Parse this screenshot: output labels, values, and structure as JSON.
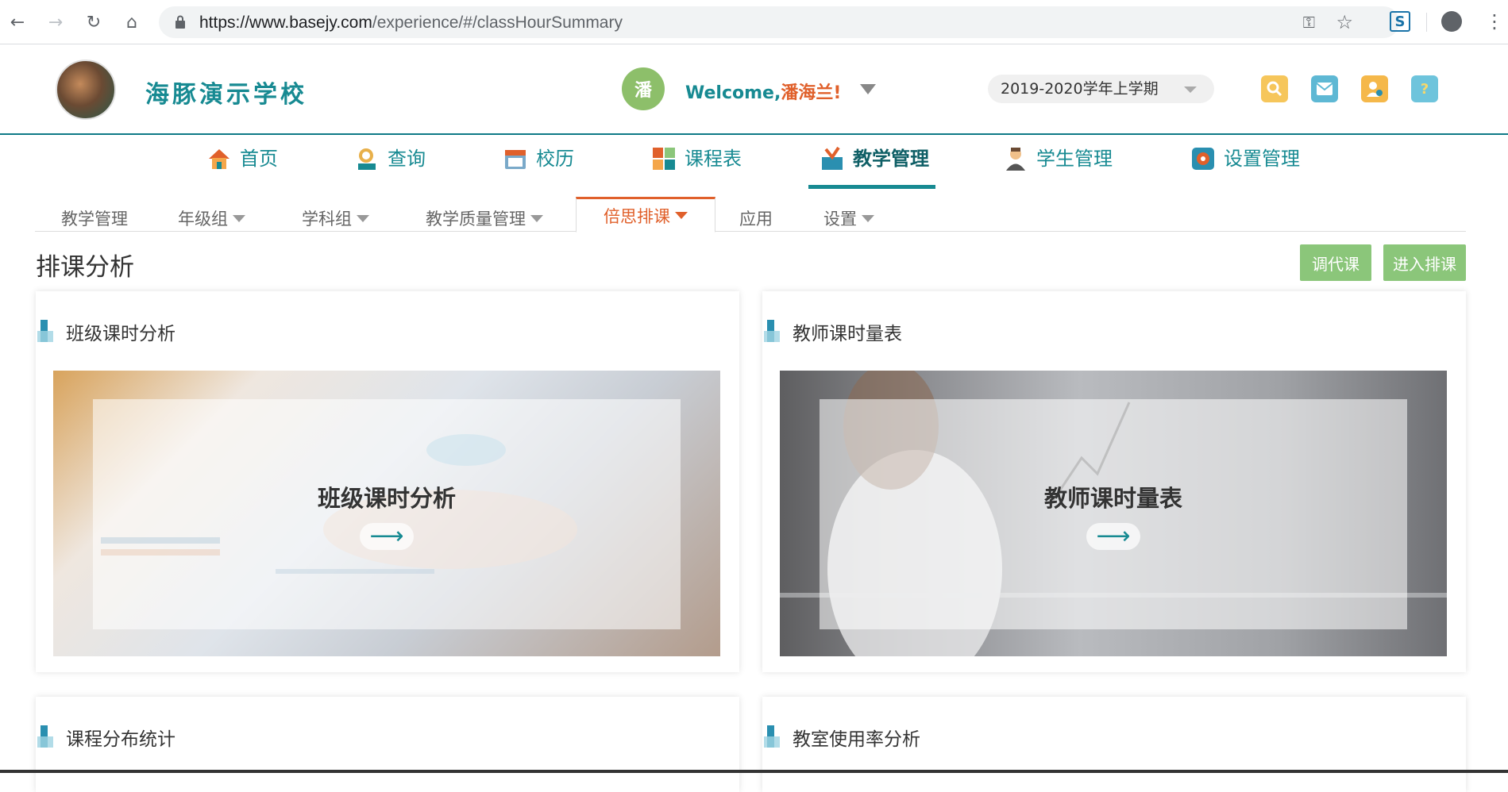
{
  "browser": {
    "url_host": "https://www.basejy.com",
    "url_path": "/experience/#/classHourSummary"
  },
  "header": {
    "school_name": "海豚演示学校",
    "avatar_char": "潘",
    "welcome_prefix": "Welcome,",
    "user_name": "潘海兰!",
    "term": "2019-2020学年上学期",
    "help_char": "?"
  },
  "main_nav": {
    "items": [
      {
        "label": "首页"
      },
      {
        "label": "查询"
      },
      {
        "label": "校历"
      },
      {
        "label": "课程表"
      },
      {
        "label": "教学管理"
      },
      {
        "label": "学生管理"
      },
      {
        "label": "设置管理"
      }
    ],
    "active": "教学管理"
  },
  "sub_nav": {
    "items": [
      {
        "label": "教学管理"
      },
      {
        "label": "年级组"
      },
      {
        "label": "学科组"
      },
      {
        "label": "教学质量管理"
      },
      {
        "label": "倍思排课"
      },
      {
        "label": "应用"
      },
      {
        "label": "设置"
      }
    ],
    "active": "倍思排课"
  },
  "page": {
    "title": "排课分析",
    "btn_swap": "调代课",
    "btn_enter": "进入排课"
  },
  "panels": [
    {
      "title": "班级课时分析",
      "card_label": "班级课时分析"
    },
    {
      "title": "教师课时量表",
      "card_label": "教师课时量表"
    },
    {
      "title": "课程分布统计"
    },
    {
      "title": "教室使用率分析"
    }
  ],
  "arrow_glyph": "⟶",
  "colors": {
    "brand_teal": "#178a92",
    "accent_orange": "#e0602b",
    "button_green": "#8bc67a"
  }
}
